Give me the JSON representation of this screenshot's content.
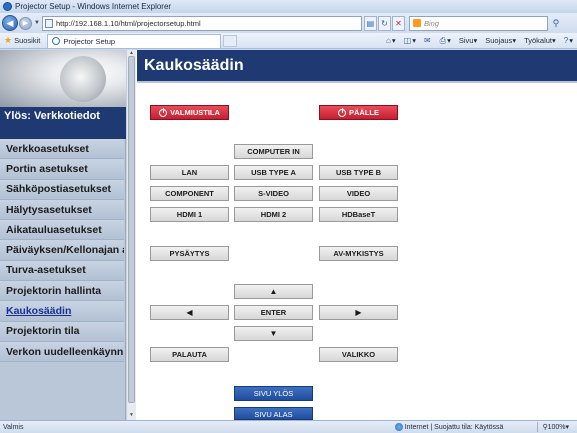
{
  "window": {
    "title": "Projector Setup - Windows Internet Explorer"
  },
  "address": {
    "url": "http://192.168.1.10/html/projectorsetup.html",
    "search_placeholder": "Bing"
  },
  "favorites": {
    "label": "Suosikit",
    "tab_title": "Projector Setup"
  },
  "command_bar": {
    "page": "Sivu",
    "safety": "Suojaus",
    "tools": "Työkalut"
  },
  "sidebar": {
    "up_label": "Ylös: Verkkotiedot",
    "items": [
      {
        "label": "Verkkoasetukset"
      },
      {
        "label": "Portin asetukset"
      },
      {
        "label": "Sähköpostiasetukset"
      },
      {
        "label": "Hälytysasetukset"
      },
      {
        "label": "Aikatauluasetukset"
      },
      {
        "label": "Päiväyksen/Kellonajan asetukset"
      },
      {
        "label": "Turva-asetukset"
      },
      {
        "label": "Projektorin hallinta"
      },
      {
        "label": "Kaukosäädin"
      },
      {
        "label": "Projektorin tila"
      },
      {
        "label": "Verkon uudelleenkäynnistys"
      }
    ],
    "active_index": 8
  },
  "main": {
    "title": "Kaukosäädin",
    "standby": "VALMIUSTILA",
    "power_on": "PÄÄLLE",
    "computer_in": "COMPUTER IN",
    "lan": "LAN",
    "usb_a": "USB TYPE A",
    "usb_b": "USB TYPE B",
    "component": "COMPONENT",
    "svideo": "S-VIDEO",
    "video": "VIDEO",
    "hdmi1": "HDMI 1",
    "hdmi2": "HDMI 2",
    "hdbaset": "HDBaseT",
    "freeze": "PYSÄYTYS",
    "av_mute": "AV-MYKISTYS",
    "up": "▲",
    "left": "◀",
    "enter": "ENTER",
    "right": "▶",
    "down": "▼",
    "back": "PALAUTA",
    "menu": "VALIKKO",
    "page_up": "SIVU YLÖS",
    "page_down": "SIVU ALAS"
  },
  "status": {
    "text": "Valmis",
    "zone": "Internet | Suojattu tila: Käytössä",
    "zoom": "100%"
  }
}
